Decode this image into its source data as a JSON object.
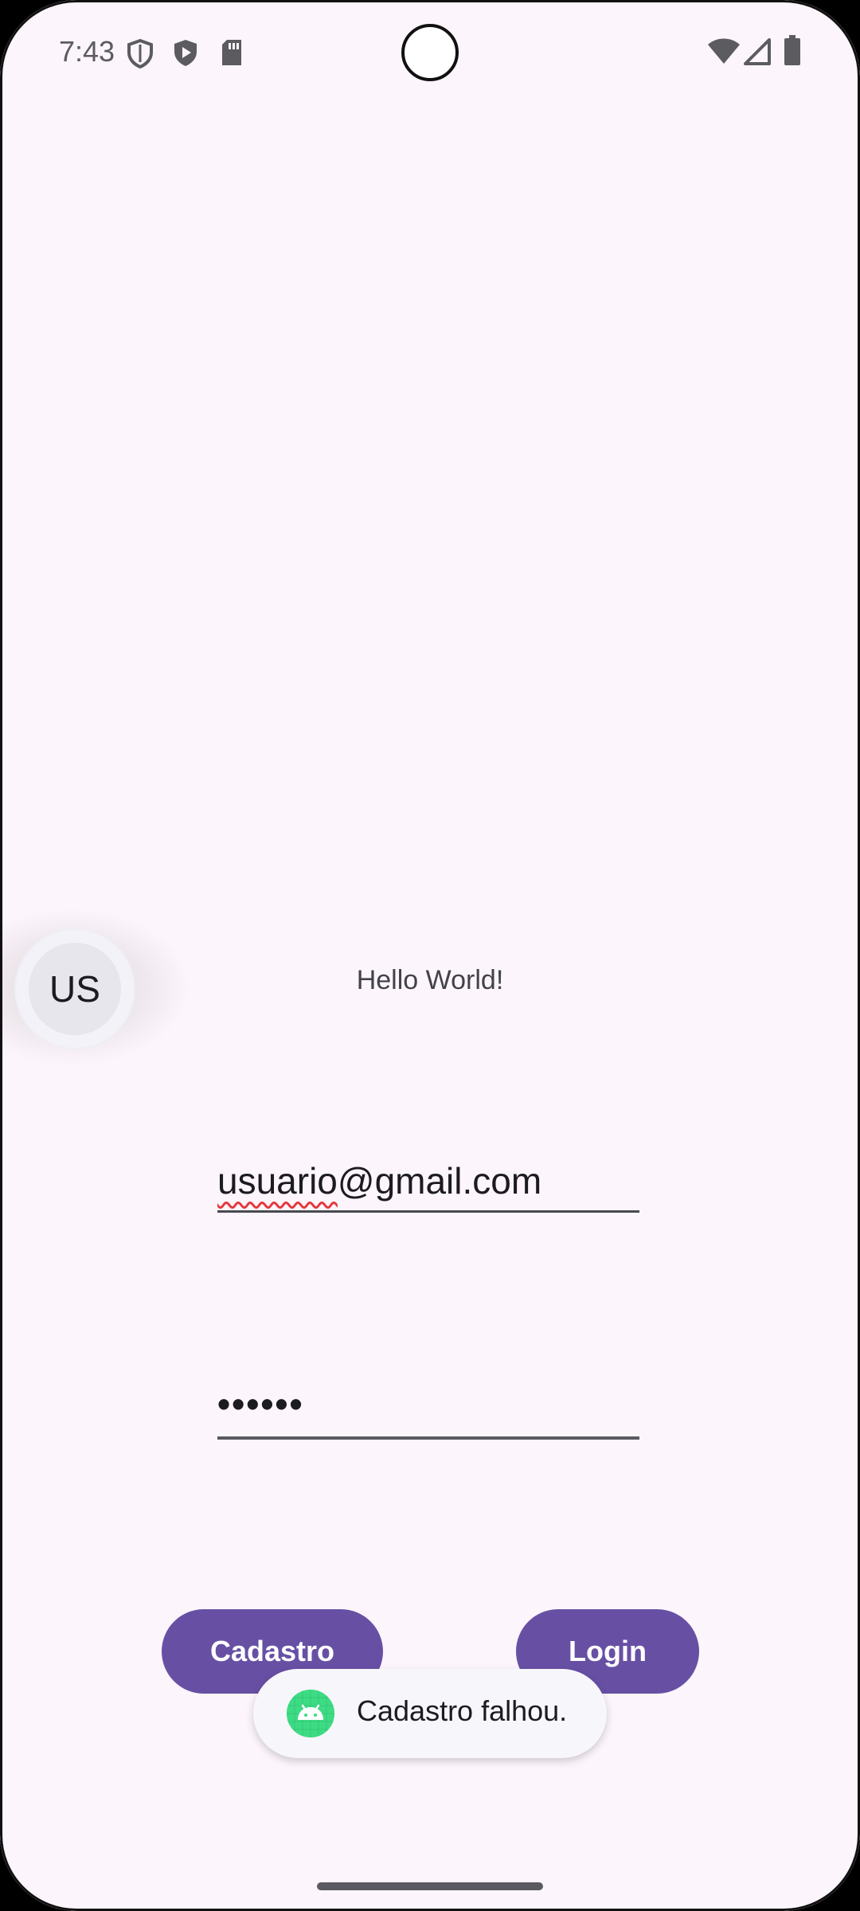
{
  "status_bar": {
    "time": "7:43",
    "icons": [
      "shield-outline-icon",
      "play-protect-icon",
      "sd-card-icon",
      "wifi-icon",
      "cellular-signal-icon",
      "battery-icon"
    ]
  },
  "bubble": {
    "initials": "US"
  },
  "main": {
    "hello_text": "Hello World!",
    "email_value_part1": "usuario",
    "email_value_part2": "@gmail.com",
    "password_value": "••••••",
    "register_button_label": "Cadastro",
    "login_button_label": "Login"
  },
  "toast": {
    "message": "Cadastro falhou.",
    "icon": "android-icon"
  },
  "colors": {
    "background": "#fcf5fb",
    "primary": "#6750a4",
    "toast_icon": "#3ddc84",
    "spell_underline": "#e5393d"
  }
}
